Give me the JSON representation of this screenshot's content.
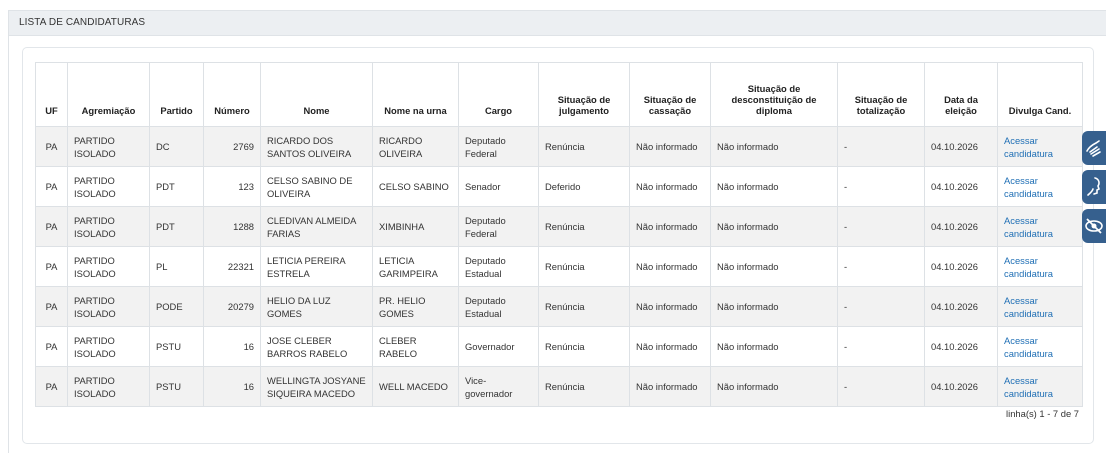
{
  "panel": {
    "title": "LISTA DE CANDIDATURAS"
  },
  "table": {
    "headers": [
      "UF",
      "Agremiação",
      "Partido",
      "Número",
      "Nome",
      "Nome na urna",
      "Cargo",
      "Situação de julgamento",
      "Situação de cassação",
      "Situação de desconstituição de diploma",
      "Situação de totalização",
      "Data da eleição",
      "Divulga Cand."
    ],
    "rows": [
      {
        "uf": "PA",
        "agremiacao": "PARTIDO ISOLADO",
        "partido": "DC",
        "numero": "2769",
        "nome": "RICARDO DOS SANTOS OLIVEIRA",
        "nome_urna": "RICARDO OLIVEIRA",
        "cargo": "Deputado Federal",
        "julgamento": "Renúncia",
        "cassacao": "Não informado",
        "desconstituicao": "Não informado",
        "totalizacao": "-",
        "data": "04.10.2026",
        "divulga": "Acessar candidatura"
      },
      {
        "uf": "PA",
        "agremiacao": "PARTIDO ISOLADO",
        "partido": "PDT",
        "numero": "123",
        "nome": "CELSO SABINO DE OLIVEIRA",
        "nome_urna": "CELSO SABINO",
        "cargo": "Senador",
        "julgamento": "Deferido",
        "cassacao": "Não informado",
        "desconstituicao": "Não informado",
        "totalizacao": "-",
        "data": "04.10.2026",
        "divulga": "Acessar candidatura"
      },
      {
        "uf": "PA",
        "agremiacao": "PARTIDO ISOLADO",
        "partido": "PDT",
        "numero": "1288",
        "nome": "CLEDIVAN ALMEIDA FARIAS",
        "nome_urna": "XIMBINHA",
        "cargo": "Deputado Federal",
        "julgamento": "Renúncia",
        "cassacao": "Não informado",
        "desconstituicao": "Não informado",
        "totalizacao": "-",
        "data": "04.10.2026",
        "divulga": "Acessar candidatura"
      },
      {
        "uf": "PA",
        "agremiacao": "PARTIDO ISOLADO",
        "partido": "PL",
        "numero": "22321",
        "nome": "LETICIA PEREIRA ESTRELA",
        "nome_urna": "LETICIA GARIMPEIRA",
        "cargo": "Deputado Estadual",
        "julgamento": "Renúncia",
        "cassacao": "Não informado",
        "desconstituicao": "Não informado",
        "totalizacao": "-",
        "data": "04.10.2026",
        "divulga": "Acessar candidatura"
      },
      {
        "uf": "PA",
        "agremiacao": "PARTIDO ISOLADO",
        "partido": "PODE",
        "numero": "20279",
        "nome": "HELIO DA LUZ GOMES",
        "nome_urna": "PR. HELIO GOMES",
        "cargo": "Deputado Estadual",
        "julgamento": "Renúncia",
        "cassacao": "Não informado",
        "desconstituicao": "Não informado",
        "totalizacao": "-",
        "data": "04.10.2026",
        "divulga": "Acessar candidatura"
      },
      {
        "uf": "PA",
        "agremiacao": "PARTIDO ISOLADO",
        "partido": "PSTU",
        "numero": "16",
        "nome": "JOSE CLEBER BARROS RABELO",
        "nome_urna": "CLEBER RABELO",
        "cargo": "Governador",
        "julgamento": "Renúncia",
        "cassacao": "Não informado",
        "desconstituicao": "Não informado",
        "totalizacao": "-",
        "data": "04.10.2026",
        "divulga": "Acessar candidatura"
      },
      {
        "uf": "PA",
        "agremiacao": "PARTIDO ISOLADO",
        "partido": "PSTU",
        "numero": "16",
        "nome": "WELLINGTA JOSYANE SIQUEIRA MACEDO",
        "nome_urna": "WELL MACEDO",
        "cargo": "Vice-governador",
        "julgamento": "Renúncia",
        "cassacao": "Não informado",
        "desconstituicao": "Não informado",
        "totalizacao": "-",
        "data": "04.10.2026",
        "divulga": "Acessar candidatura"
      }
    ],
    "footer": "linha(s) 1 - 7 de 7"
  },
  "accessibility_buttons": [
    {
      "icon": "sign-language-icon"
    },
    {
      "icon": "audio-description-icon"
    },
    {
      "icon": "low-vision-icon"
    }
  ],
  "colors": {
    "accent": "#36608e",
    "link": "#1f6fb5",
    "header_bg": "#eceff2",
    "row_alt": "#f2f2f2"
  }
}
